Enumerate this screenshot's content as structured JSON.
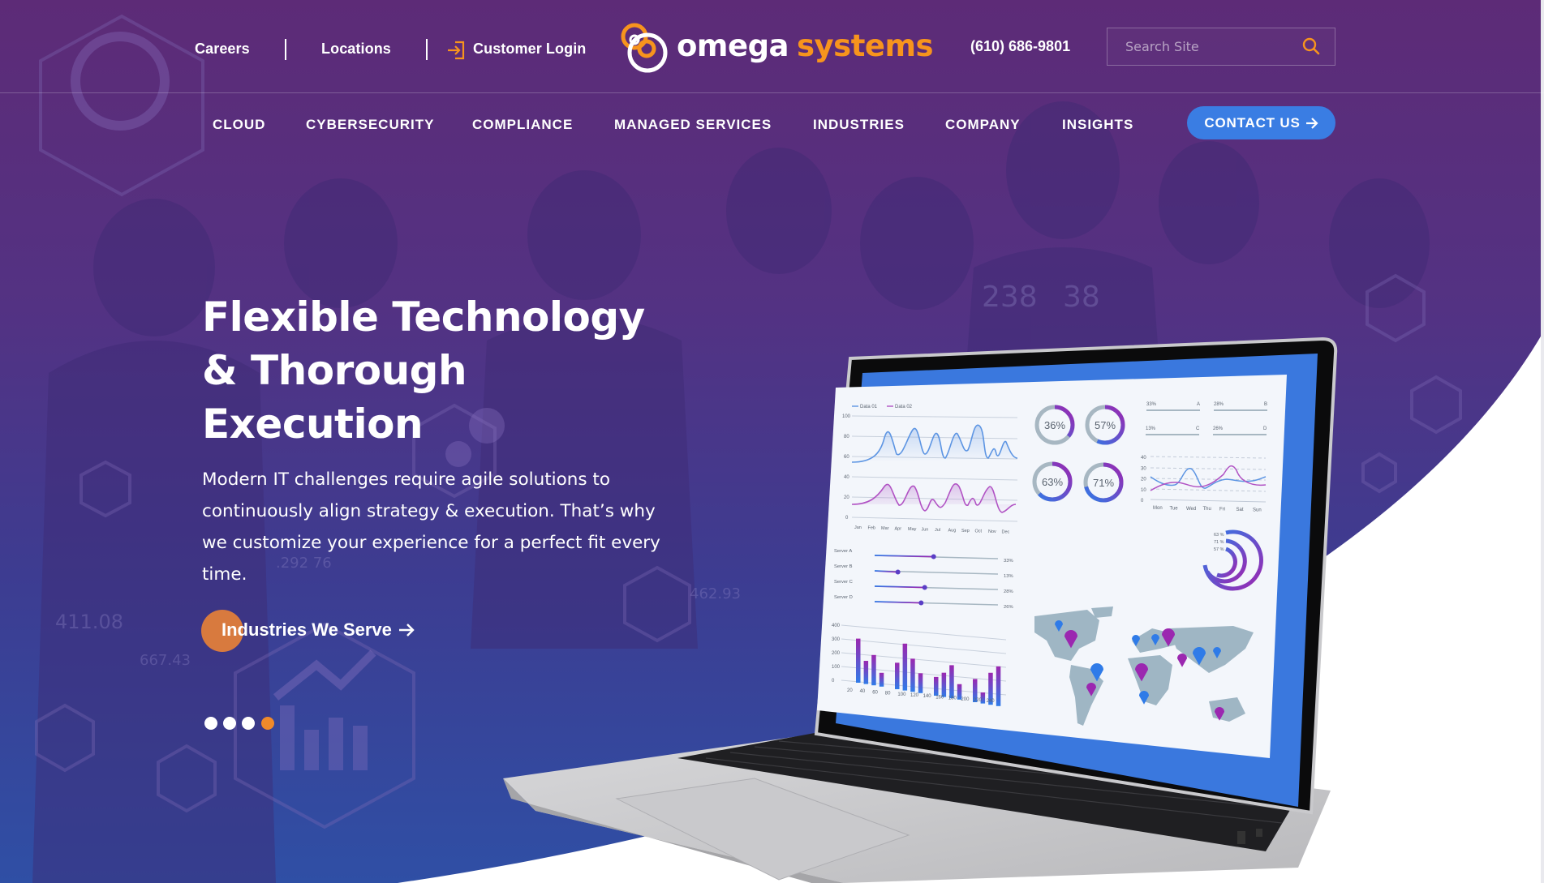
{
  "topbar": {
    "links": [
      {
        "label": "Careers"
      },
      {
        "label": "Locations"
      },
      {
        "label": "Customer Login",
        "icon": "login-arrow-icon"
      }
    ],
    "logo": {
      "word1": "omega",
      "word2": "systems"
    },
    "phone": "(610) 686-9801",
    "search": {
      "placeholder": "Search Site",
      "value": "",
      "icon": "search-icon"
    }
  },
  "nav": {
    "items": [
      {
        "label": "CLOUD"
      },
      {
        "label": "CYBERSECURITY"
      },
      {
        "label": "COMPLIANCE"
      },
      {
        "label": "MANAGED SERVICES"
      },
      {
        "label": "INDUSTRIES"
      },
      {
        "label": "COMPANY"
      },
      {
        "label": "INSIGHTS"
      }
    ],
    "contact_button": {
      "label": "CONTACT US",
      "icon": "arrow-right-icon"
    }
  },
  "hero": {
    "title_lines": [
      "Flexible Technology",
      "& Thorough",
      "Execution"
    ],
    "body": "Modern IT challenges require agile solutions to continuously align strategy & execution. That’s why we customize your experience for a perfect fit every time.",
    "cta": {
      "label": "Industries We Serve",
      "icon": "arrow-right-icon"
    },
    "carousel": {
      "total": 4,
      "active_index": 3
    }
  },
  "colors": {
    "brand_orange": "#f7941d",
    "hero_purple_top": "#5b2c78",
    "hero_blue_bottom": "#2f4ea3",
    "contact_blue": "#3a7de3",
    "cta_orange": "#d87a3e",
    "screen_blue": "#3a78de"
  },
  "laptop_dashboard": {
    "line_chart": {
      "legend": [
        "Data 01",
        "Data 02"
      ],
      "y_ticks": [
        "100",
        "80",
        "60",
        "40",
        "20",
        "0"
      ],
      "x_ticks": [
        "Jan",
        "Feb",
        "Mar",
        "Apr",
        "May",
        "Jun",
        "Jul",
        "Aug",
        "Sep",
        "Oct",
        "Nov",
        "Dec"
      ]
    },
    "donuts": [
      "36%",
      "57%",
      "63%",
      "71%"
    ],
    "progress_labels": [
      {
        "pct": "33%",
        "key": "A"
      },
      {
        "pct": "28%",
        "key": "B"
      },
      {
        "pct": "13%",
        "key": "C"
      },
      {
        "pct": "26%",
        "key": "D"
      }
    ],
    "week_chart": {
      "y_ticks": [
        "40",
        "30",
        "20",
        "10",
        "0"
      ],
      "x_ticks": [
        "Mon",
        "Tue",
        "Wed",
        "Thu",
        "Fri",
        "Sat",
        "Sun"
      ]
    },
    "servers": [
      {
        "name": "Server A",
        "pct": "33%"
      },
      {
        "name": "Server B",
        "pct": "13%"
      },
      {
        "name": "Server C",
        "pct": "28%"
      },
      {
        "name": "Server D",
        "pct": "26%"
      }
    ],
    "radial_labels": [
      "63 %",
      "71 %",
      "57 %"
    ],
    "bar_chart": {
      "y_ticks": [
        "400",
        "300",
        "200",
        "100",
        "0"
      ],
      "x_ticks": [
        "20",
        "40",
        "60",
        "80",
        "100",
        "120",
        "140",
        "160",
        "180",
        "200",
        "220",
        "240"
      ]
    }
  }
}
